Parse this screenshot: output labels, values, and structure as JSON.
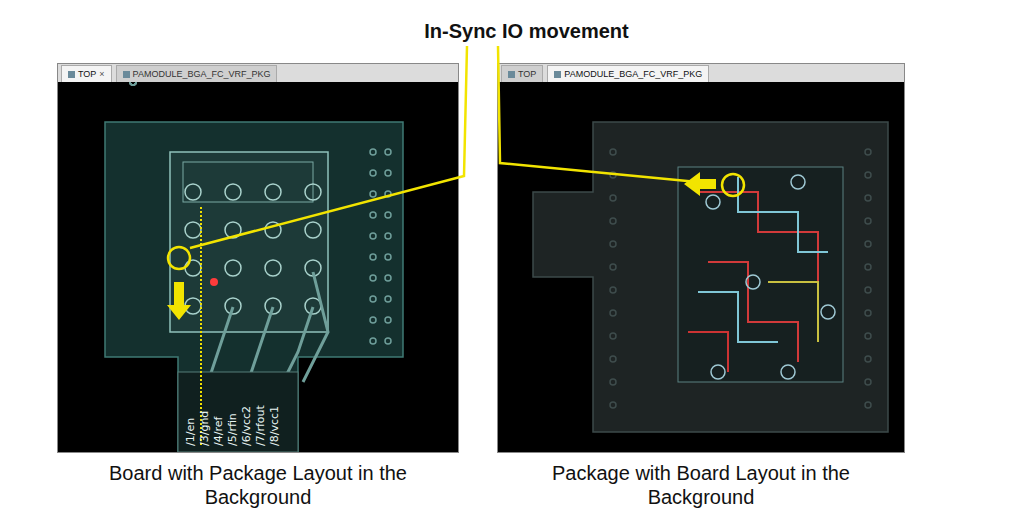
{
  "title": "In-Sync IO movement",
  "windows": [
    {
      "kind": "board",
      "tabs": [
        {
          "label": "TOP",
          "close": "×",
          "selected": true
        },
        {
          "label": "PAMODULE_BGA_FC_VRF_PKG",
          "close": "",
          "selected": false
        }
      ],
      "pins": [
        "/1/en",
        "/3/gnd",
        "/4/ref",
        "/5/rfin",
        "/6/vcc2",
        "/7/rfout",
        "/8/vcc1"
      ],
      "caption": "Board with Package Layout in the Background"
    },
    {
      "kind": "package",
      "tabs": [
        {
          "label": "TOP",
          "close": "",
          "selected": false
        },
        {
          "label": "PAMODULE_BGA_FC_VRF_PKG",
          "close": "",
          "selected": true
        }
      ],
      "pins": [],
      "caption": "Package with Board Layout in the Background"
    }
  ]
}
